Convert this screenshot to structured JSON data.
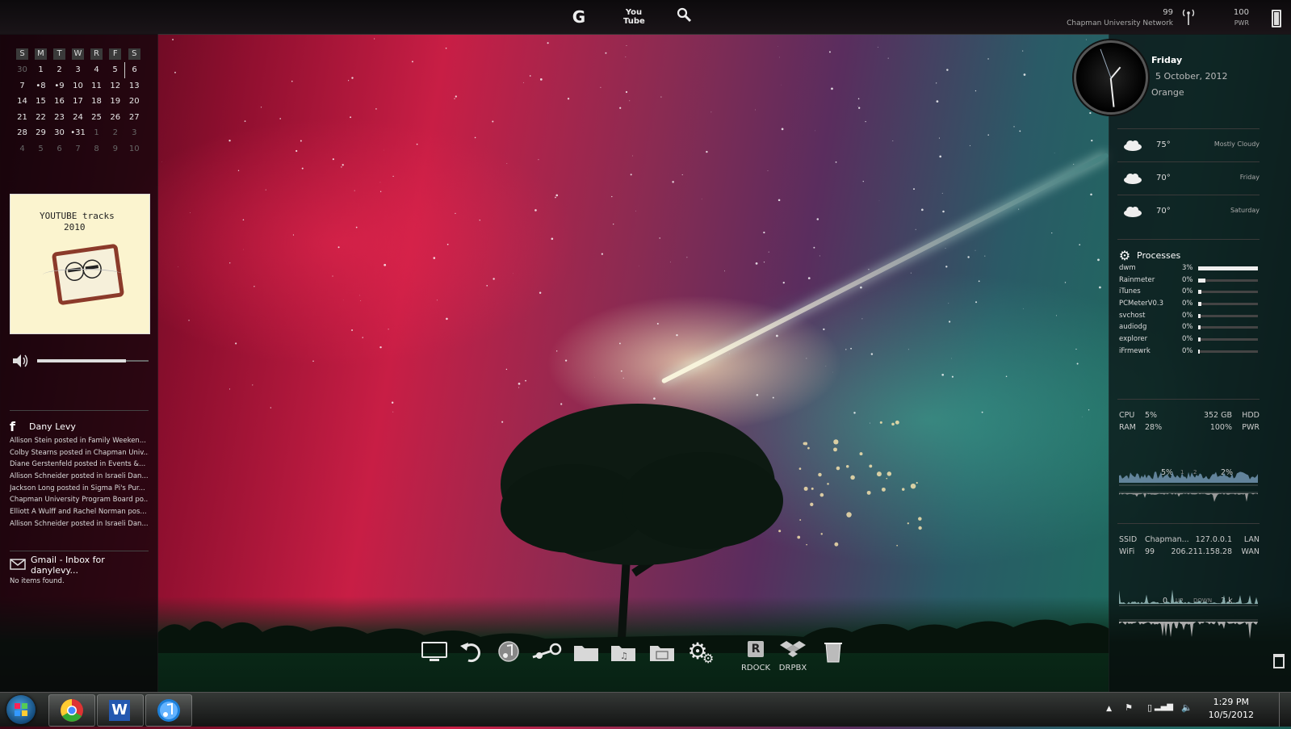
{
  "topbar": {
    "icons": [
      "google-icon",
      "youtube-icon",
      "search-icon"
    ],
    "google_label": "G",
    "youtube_label": "You\nTube",
    "wifi_value": "99",
    "network_name": "Chapman University Network",
    "power_value": "100",
    "power_label": "PWR"
  },
  "calendar": {
    "weekdays": [
      "S",
      "M",
      "T",
      "W",
      "R",
      "F",
      "S"
    ],
    "weeks": [
      [
        "30",
        "1",
        "2",
        "3",
        "4",
        "5",
        "6"
      ],
      [
        "7",
        "•8",
        "•9",
        "10",
        "11",
        "12",
        "13"
      ],
      [
        "14",
        "15",
        "16",
        "17",
        "18",
        "19",
        "20"
      ],
      [
        "21",
        "22",
        "23",
        "24",
        "25",
        "26",
        "27"
      ],
      [
        "28",
        "29",
        "30",
        "•31",
        "1",
        "2",
        "3"
      ],
      [
        "4",
        "5",
        "6",
        "7",
        "8",
        "9",
        "10"
      ]
    ]
  },
  "album": {
    "line1": "YOUTUBE tracks",
    "line2": "2010"
  },
  "volume": {
    "level": 0.8
  },
  "facebook": {
    "user": "Dany Levy",
    "posts": [
      "Allison Stein posted in Family Weeken...",
      "Colby Stearns posted in Chapman Univ...",
      "Diane Gerstenfeld posted in Events &...",
      "Allison Schneider posted in Israeli Dan...",
      "Jackson Long posted in Sigma Pi's Pur...",
      "Chapman University Program Board po...",
      "Elliott A Wulff and Rachel Norman pos...",
      "Allison Schneider posted in Israeli Dan..."
    ]
  },
  "gmail": {
    "title": "Gmail - Inbox for danylevy...",
    "body": "No items found."
  },
  "clock": {
    "day": "Friday",
    "date": "5 October, 2012",
    "location": "Orange"
  },
  "weather": [
    {
      "temp": "75°",
      "desc": "Mostly Cloudy",
      "icon": "cloud-icon"
    },
    {
      "temp": "70°",
      "desc": "Friday",
      "icon": "partly-sunny-icon"
    },
    {
      "temp": "70°",
      "desc": "Saturday",
      "icon": "partly-sunny-icon"
    }
  ],
  "processes": {
    "title": "Processes",
    "items": [
      {
        "name": "dwm",
        "pct": "3%",
        "level": 1.0
      },
      {
        "name": "Rainmeter",
        "pct": "0%",
        "level": 0.12
      },
      {
        "name": "iTunes",
        "pct": "0%",
        "level": 0.06
      },
      {
        "name": "PCMeterV0.3",
        "pct": "0%",
        "level": 0.06
      },
      {
        "name": "svchost",
        "pct": "0%",
        "level": 0.04
      },
      {
        "name": "audiodg",
        "pct": "0%",
        "level": 0.04
      },
      {
        "name": "explorer",
        "pct": "0%",
        "level": 0.04
      },
      {
        "name": "iFrmewrk",
        "pct": "0%",
        "level": 0.03
      }
    ]
  },
  "system": {
    "cpu_label": "CPU",
    "cpu": "5%",
    "ram_label": "RAM",
    "ram": "28%",
    "hdd": "352 GB",
    "hdd_label": "HDD",
    "pwr": "100%",
    "pwr_label": "PWR",
    "core1": "5%",
    "core1_id": "1",
    "core2_id": "2",
    "core2": "2%"
  },
  "network": {
    "ssid_label": "SSID",
    "ssid": "Chapman...",
    "wifi_label": "WiFi",
    "wifi": "99",
    "lan_ip": "127.0.0.1",
    "lan_label": "LAN",
    "wan_ip": "206.211.158.28",
    "wan_label": "WAN",
    "up": "0",
    "up_label": "UP",
    "down_label": "DOWN",
    "down": "3 k"
  },
  "dock": {
    "items": [
      {
        "name": "computer-icon",
        "label": ""
      },
      {
        "name": "restore-icon",
        "label": ""
      },
      {
        "name": "itunes-icon",
        "label": ""
      },
      {
        "name": "steam-icon",
        "label": ""
      },
      {
        "name": "folder-icon",
        "label": ""
      },
      {
        "name": "music-folder-icon",
        "label": ""
      },
      {
        "name": "pictures-folder-icon",
        "label": ""
      },
      {
        "name": "settings-icon",
        "label": ""
      },
      {
        "name": "rdock-icon",
        "label": "RDOCK"
      },
      {
        "name": "dropbox-icon",
        "label": "DRPBX"
      },
      {
        "name": "recycle-bin-icon",
        "label": ""
      }
    ]
  },
  "taskbar": {
    "apps": [
      "chrome-icon",
      "word-icon",
      "itunes-icon"
    ],
    "word_letter": "W",
    "time": "1:29 PM",
    "date": "10/5/2012"
  }
}
